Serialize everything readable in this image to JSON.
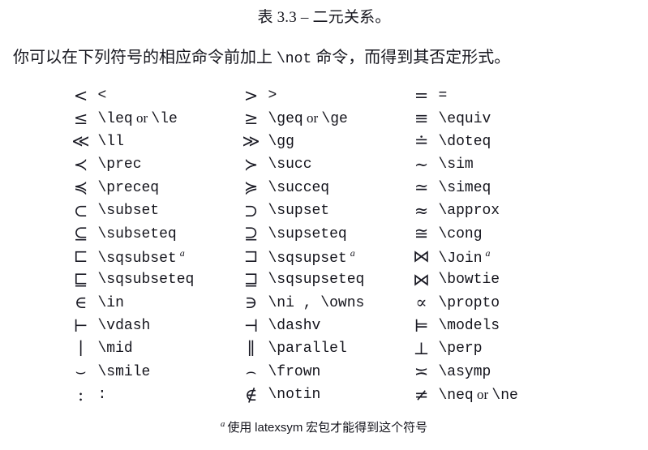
{
  "caption": "表 3.3 – 二元关系。",
  "intro": {
    "before": "你可以在下列符号的相应命令前加上 ",
    "command": "\\not",
    "after": " 命令，而得到其否定形式。"
  },
  "table": {
    "rows": [
      {
        "c1": {
          "symbol": "<",
          "command": "<",
          "footnote": false
        },
        "c2": {
          "symbol": ">",
          "command": ">",
          "footnote": false
        },
        "c3": {
          "symbol": "=",
          "command": "=",
          "footnote": false
        }
      },
      {
        "c1": {
          "symbol": "≤",
          "command": "\\leq",
          "or": "\\le",
          "footnote": false
        },
        "c2": {
          "symbol": "≥",
          "command": "\\geq",
          "or": "\\ge",
          "footnote": false
        },
        "c3": {
          "symbol": "≡",
          "command": "\\equiv",
          "footnote": false
        }
      },
      {
        "c1": {
          "symbol": "≪",
          "command": "\\ll",
          "footnote": false
        },
        "c2": {
          "symbol": "≫",
          "command": "\\gg",
          "footnote": false
        },
        "c3": {
          "symbol": "≐",
          "command": "\\doteq",
          "footnote": false
        }
      },
      {
        "c1": {
          "symbol": "≺",
          "command": "\\prec",
          "footnote": false
        },
        "c2": {
          "symbol": "≻",
          "command": "\\succ",
          "footnote": false
        },
        "c3": {
          "symbol": "∼",
          "command": "\\sim",
          "footnote": false
        }
      },
      {
        "c1": {
          "symbol": "≼",
          "command": "\\preceq",
          "footnote": false
        },
        "c2": {
          "symbol": "≽",
          "command": "\\succeq",
          "footnote": false
        },
        "c3": {
          "symbol": "≃",
          "command": "\\simeq",
          "footnote": false
        }
      },
      {
        "c1": {
          "symbol": "⊂",
          "command": "\\subset",
          "footnote": false
        },
        "c2": {
          "symbol": "⊃",
          "command": "\\supset",
          "footnote": false
        },
        "c3": {
          "symbol": "≈",
          "command": "\\approx",
          "footnote": false
        }
      },
      {
        "c1": {
          "symbol": "⊆",
          "command": "\\subseteq",
          "footnote": false
        },
        "c2": {
          "symbol": "⊇",
          "command": "\\supseteq",
          "footnote": false
        },
        "c3": {
          "symbol": "≅",
          "command": "\\cong",
          "footnote": false
        }
      },
      {
        "c1": {
          "symbol": "⊏",
          "command": "\\sqsubset",
          "footnote": true
        },
        "c2": {
          "symbol": "⊐",
          "command": "\\sqsupset",
          "footnote": true
        },
        "c3": {
          "symbol": "⋈",
          "command": "\\Join",
          "footnote": true
        }
      },
      {
        "c1": {
          "symbol": "⊑",
          "command": "\\sqsubseteq",
          "footnote": false
        },
        "c2": {
          "symbol": "⊒",
          "command": "\\sqsupseteq",
          "footnote": false
        },
        "c3": {
          "symbol": "⋈",
          "command": "\\bowtie",
          "footnote": false
        }
      },
      {
        "c1": {
          "symbol": "∈",
          "command": "\\in",
          "footnote": false
        },
        "c2": {
          "symbol": "∋",
          "command": "\\ni , \\owns",
          "footnote": false
        },
        "c3": {
          "symbol": "∝",
          "command": "\\propto",
          "footnote": false
        }
      },
      {
        "c1": {
          "symbol": "⊢",
          "command": "\\vdash",
          "footnote": false
        },
        "c2": {
          "symbol": "⊣",
          "command": "\\dashv",
          "footnote": false
        },
        "c3": {
          "symbol": "⊨",
          "command": "\\models",
          "footnote": false
        }
      },
      {
        "c1": {
          "symbol": "∣",
          "command": "\\mid",
          "footnote": false
        },
        "c2": {
          "symbol": "∥",
          "command": "\\parallel",
          "footnote": false
        },
        "c3": {
          "symbol": "⊥",
          "command": "\\perp",
          "footnote": false
        }
      },
      {
        "c1": {
          "symbol": "⌣",
          "command": "\\smile",
          "footnote": false
        },
        "c2": {
          "symbol": "⌢",
          "command": "\\frown",
          "footnote": false
        },
        "c3": {
          "symbol": "≍",
          "command": "\\asymp",
          "footnote": false
        }
      },
      {
        "c1": {
          "symbol": ":",
          "command": ":",
          "footnote": false
        },
        "c2": {
          "symbol": "∉",
          "command": "\\notin",
          "footnote": false
        },
        "c3": {
          "symbol": "≠",
          "command": "\\neq",
          "or": "\\ne",
          "footnote": false
        }
      }
    ]
  },
  "footnote": {
    "marker": "a",
    "before": "使用 ",
    "package": "latexsym",
    "after": " 宏包才能得到这个符号"
  },
  "labels": {
    "or": "or"
  },
  "colors": {
    "background": "#ffffff",
    "text": "#16161e"
  }
}
